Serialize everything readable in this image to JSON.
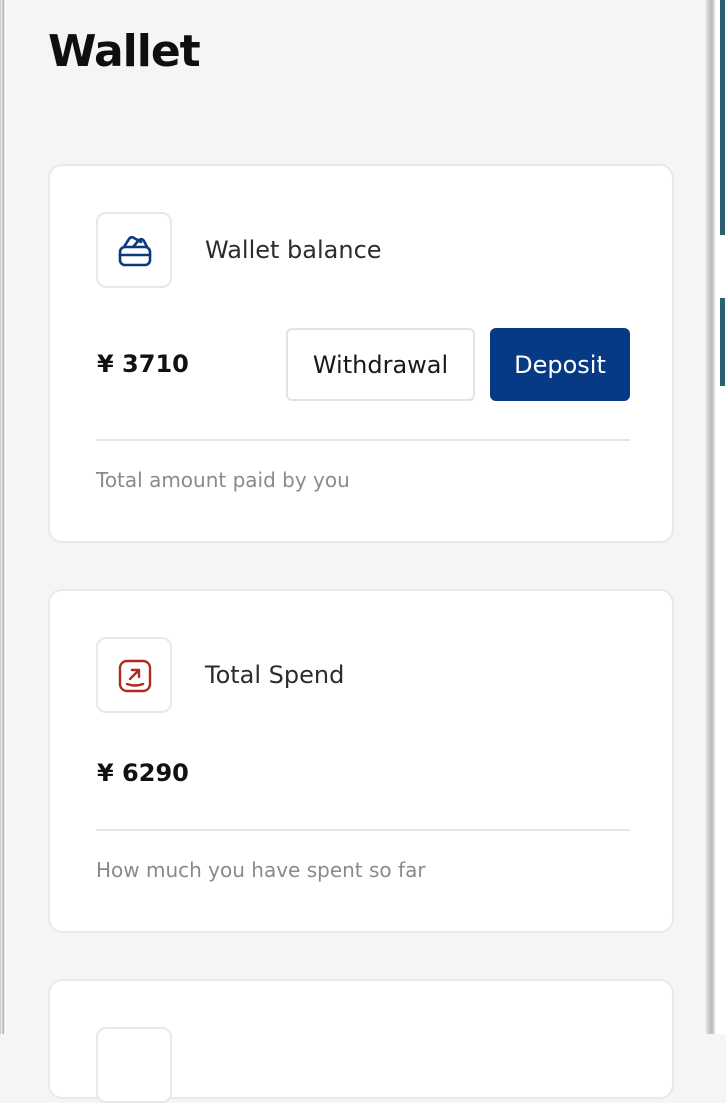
{
  "page": {
    "title": "Wallet"
  },
  "wallet_card": {
    "icon": "wallet-icon",
    "label": "Wallet balance",
    "amount": "¥ 3710",
    "withdraw_label": "Withdrawal",
    "deposit_label": "Deposit",
    "note": "Total amount paid by you"
  },
  "spend_card": {
    "icon": "arrow-up-right-box-icon",
    "label": "Total Spend",
    "amount": "¥ 6290",
    "note": "How much you have spent so far"
  },
  "colors": {
    "accent": "#073a84",
    "spend_icon": "#b02a1d",
    "wallet_icon": "#0c3a7e"
  }
}
